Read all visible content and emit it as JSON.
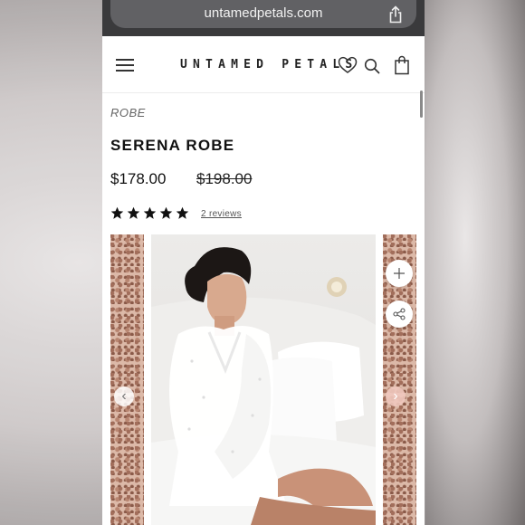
{
  "browser": {
    "url": "untamedpetals.com"
  },
  "header": {
    "logo": "UNTAMED PETALS"
  },
  "product": {
    "breadcrumb": "ROBE",
    "title": "SERENA ROBE",
    "price": "$178.00",
    "compare_price": "$198.00",
    "rating_stars": 5,
    "reviews_label": "2 reviews"
  },
  "gallery": {
    "prev_label": "‹",
    "next_label": "›"
  },
  "colors": {
    "accent": "#111111",
    "url_bar": "#3a3a3c",
    "terrazzo": "#dcb9a8"
  },
  "icons": [
    "menu-icon",
    "heart-icon",
    "search-icon",
    "bag-icon",
    "share-icon",
    "plus-icon",
    "share-nodes-icon",
    "chevron-left-icon",
    "chevron-right-icon"
  ]
}
